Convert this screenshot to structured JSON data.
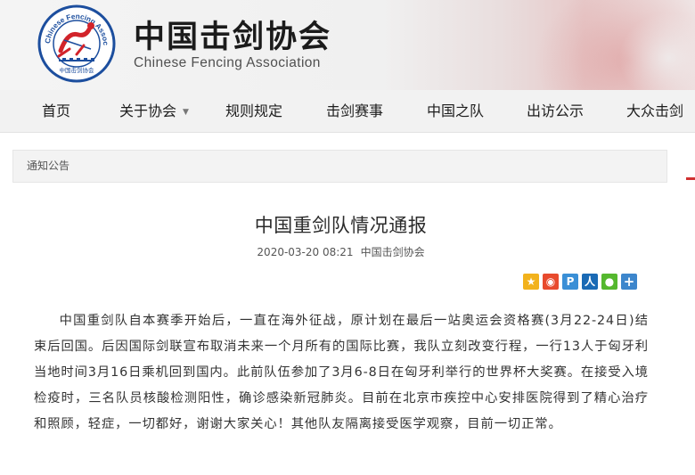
{
  "header": {
    "title": "中国击剑协会",
    "subtitle": "Chinese Fencing Association",
    "logo": {
      "ring_text": "Chinese Fencing Association",
      "bottom_text": "中国击剑协会",
      "colors": {
        "ring": "#1c4e9e",
        "fencer": "#d2232a"
      }
    }
  },
  "nav": {
    "items": [
      {
        "label": "首页"
      },
      {
        "label": "关于协会",
        "has_dropdown": true
      },
      {
        "label": "规则规定"
      },
      {
        "label": "击剑赛事"
      },
      {
        "label": "中国之队"
      },
      {
        "label": "出访公示"
      },
      {
        "label": "大众击剑"
      }
    ]
  },
  "breadcrumb": {
    "label": "通知公告"
  },
  "article": {
    "title": "中国重剑队情况通报",
    "date": "2020-03-20 08:21",
    "author": "中国击剑协会",
    "share_icons": [
      "qzone-icon",
      "weibo-icon",
      "pengyou-icon",
      "renren-icon",
      "wechat-icon",
      "more-share-icon"
    ],
    "body": "中国重剑队自本赛季开始后，一直在海外征战，原计划在最后一站奥运会资格赛(3月22-24日)结束后回国。后因国际剑联宣布取消未来一个月所有的国际比赛，我队立刻改变行程，一行13人于匈牙利当地时间3月16日乘机回到国内。此前队伍参加了3月6-8日在匈牙利举行的世界杯大奖赛。在接受入境检疫时，三名队员核酸检测阳性，确诊感染新冠肺炎。目前在北京市疾控中心安排医院得到了精心治疗和照顾，轻症，一切都好，谢谢大家关心！其他队友隔离接受医学观察，目前一切正常。"
  },
  "colors": {
    "accent_red": "#d03030",
    "nav_bg": "#f2f2f2",
    "text": "#333333"
  }
}
